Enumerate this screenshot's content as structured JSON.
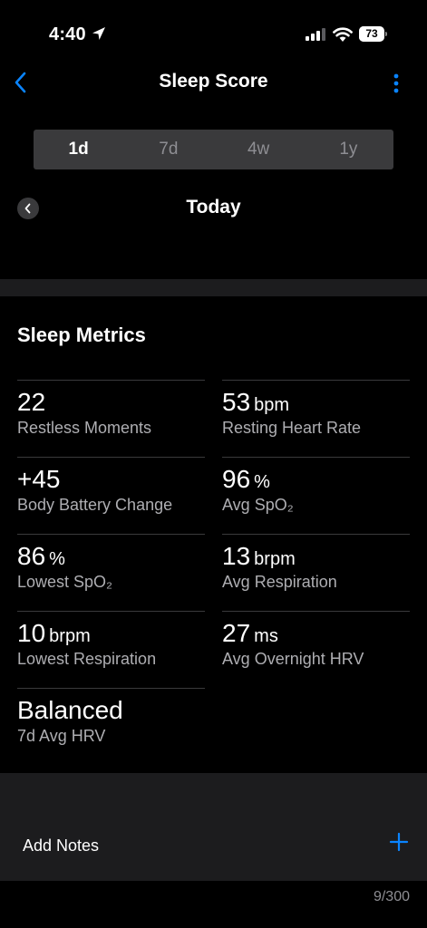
{
  "status_bar": {
    "time": "4:40",
    "battery_percent": "73",
    "battery_level": 0.73
  },
  "nav": {
    "title": "Sleep Score"
  },
  "segments": [
    {
      "label": "1d",
      "selected": true
    },
    {
      "label": "7d",
      "selected": false
    },
    {
      "label": "4w",
      "selected": false
    },
    {
      "label": "1y",
      "selected": false
    }
  ],
  "date": {
    "label": "Today"
  },
  "sleep_metrics": {
    "title": "Sleep Metrics",
    "items": [
      {
        "value": "22",
        "unit": "",
        "label": "Restless Moments"
      },
      {
        "value": "53",
        "unit": "bpm",
        "label": "Resting Heart Rate"
      },
      {
        "value": "+45",
        "unit": "",
        "label": "Body Battery Change"
      },
      {
        "value": "96",
        "unit": "%",
        "label": "Avg SpO₂"
      },
      {
        "value": "86",
        "unit": "%",
        "label": "Lowest SpO₂"
      },
      {
        "value": "13",
        "unit": "brpm",
        "label": "Avg Respiration"
      },
      {
        "value": "10",
        "unit": "brpm",
        "label": "Lowest Respiration"
      },
      {
        "value": "27",
        "unit": "ms",
        "label": "Avg Overnight HRV"
      },
      {
        "value": "Balanced",
        "unit": "",
        "label": "7d Avg HRV"
      }
    ]
  },
  "notes": {
    "label": "Add Notes",
    "char_count": "9/300"
  },
  "colors": {
    "accent": "#0a84ff",
    "background": "#000000",
    "section_gap": "#1c1c1e",
    "segment_bg": "#3a3a3c",
    "secondary_text": "#aeaeb2"
  },
  "icons": {
    "back": "chevron-left-icon",
    "more": "vertical-ellipsis-icon",
    "date_prev": "chevron-left-circle-icon",
    "add": "plus-icon",
    "location": "location-arrow-icon",
    "signal": "cellular-signal-icon",
    "wifi": "wifi-icon",
    "battery": "battery-icon"
  }
}
